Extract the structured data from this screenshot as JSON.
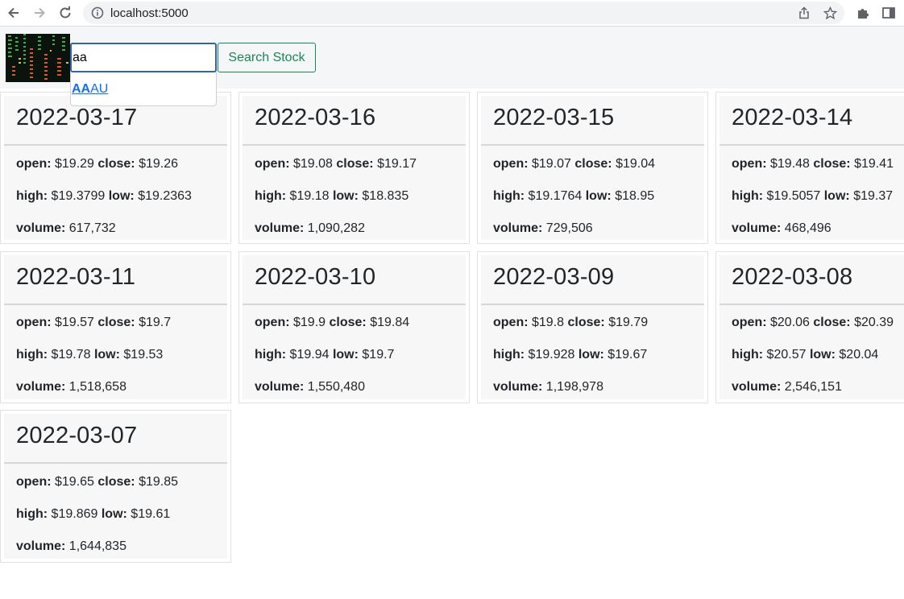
{
  "browser": {
    "url": "localhost:5000"
  },
  "colors": {
    "accent_green": "#198754",
    "input_border": "#2b64b8",
    "link_blue": "#0d6efd"
  },
  "search": {
    "value": "aa",
    "button_label": "Search Stock"
  },
  "autocomplete": {
    "match": "AA",
    "rest": "AU"
  },
  "labels": {
    "open": "open:",
    "close": "close:",
    "high": "high:",
    "low": "low:",
    "volume": "volume:"
  },
  "cards": [
    {
      "date": "2022-03-17",
      "open": "$19.29",
      "close": "$19.26",
      "high": "$19.3799",
      "low": "$19.2363",
      "volume": "617,732"
    },
    {
      "date": "2022-03-16",
      "open": "$19.08",
      "close": "$19.17",
      "high": "$19.18",
      "low": "$18.835",
      "volume": "1,090,282"
    },
    {
      "date": "2022-03-15",
      "open": "$19.07",
      "close": "$19.04",
      "high": "$19.1764",
      "low": "$18.95",
      "volume": "729,506"
    },
    {
      "date": "2022-03-14",
      "open": "$19.48",
      "close": "$19.41",
      "high": "$19.5057",
      "low": "$19.37",
      "volume": "468,496"
    },
    {
      "date": "2022-03-11",
      "open": "$19.57",
      "close": "$19.7",
      "high": "$19.78",
      "low": "$19.53",
      "volume": "1,518,658"
    },
    {
      "date": "2022-03-10",
      "open": "$19.9",
      "close": "$19.84",
      "high": "$19.94",
      "low": "$19.7",
      "volume": "1,550,480"
    },
    {
      "date": "2022-03-09",
      "open": "$19.8",
      "close": "$19.79",
      "high": "$19.928",
      "low": "$19.67",
      "volume": "1,198,978"
    },
    {
      "date": "2022-03-08",
      "open": "$20.06",
      "close": "$20.39",
      "high": "$20.57",
      "low": "$20.04",
      "volume": "2,546,151"
    },
    {
      "date": "2022-03-07",
      "open": "$19.65",
      "close": "$19.85",
      "high": "$19.869",
      "low": "$19.61",
      "volume": "1,644,835"
    }
  ]
}
